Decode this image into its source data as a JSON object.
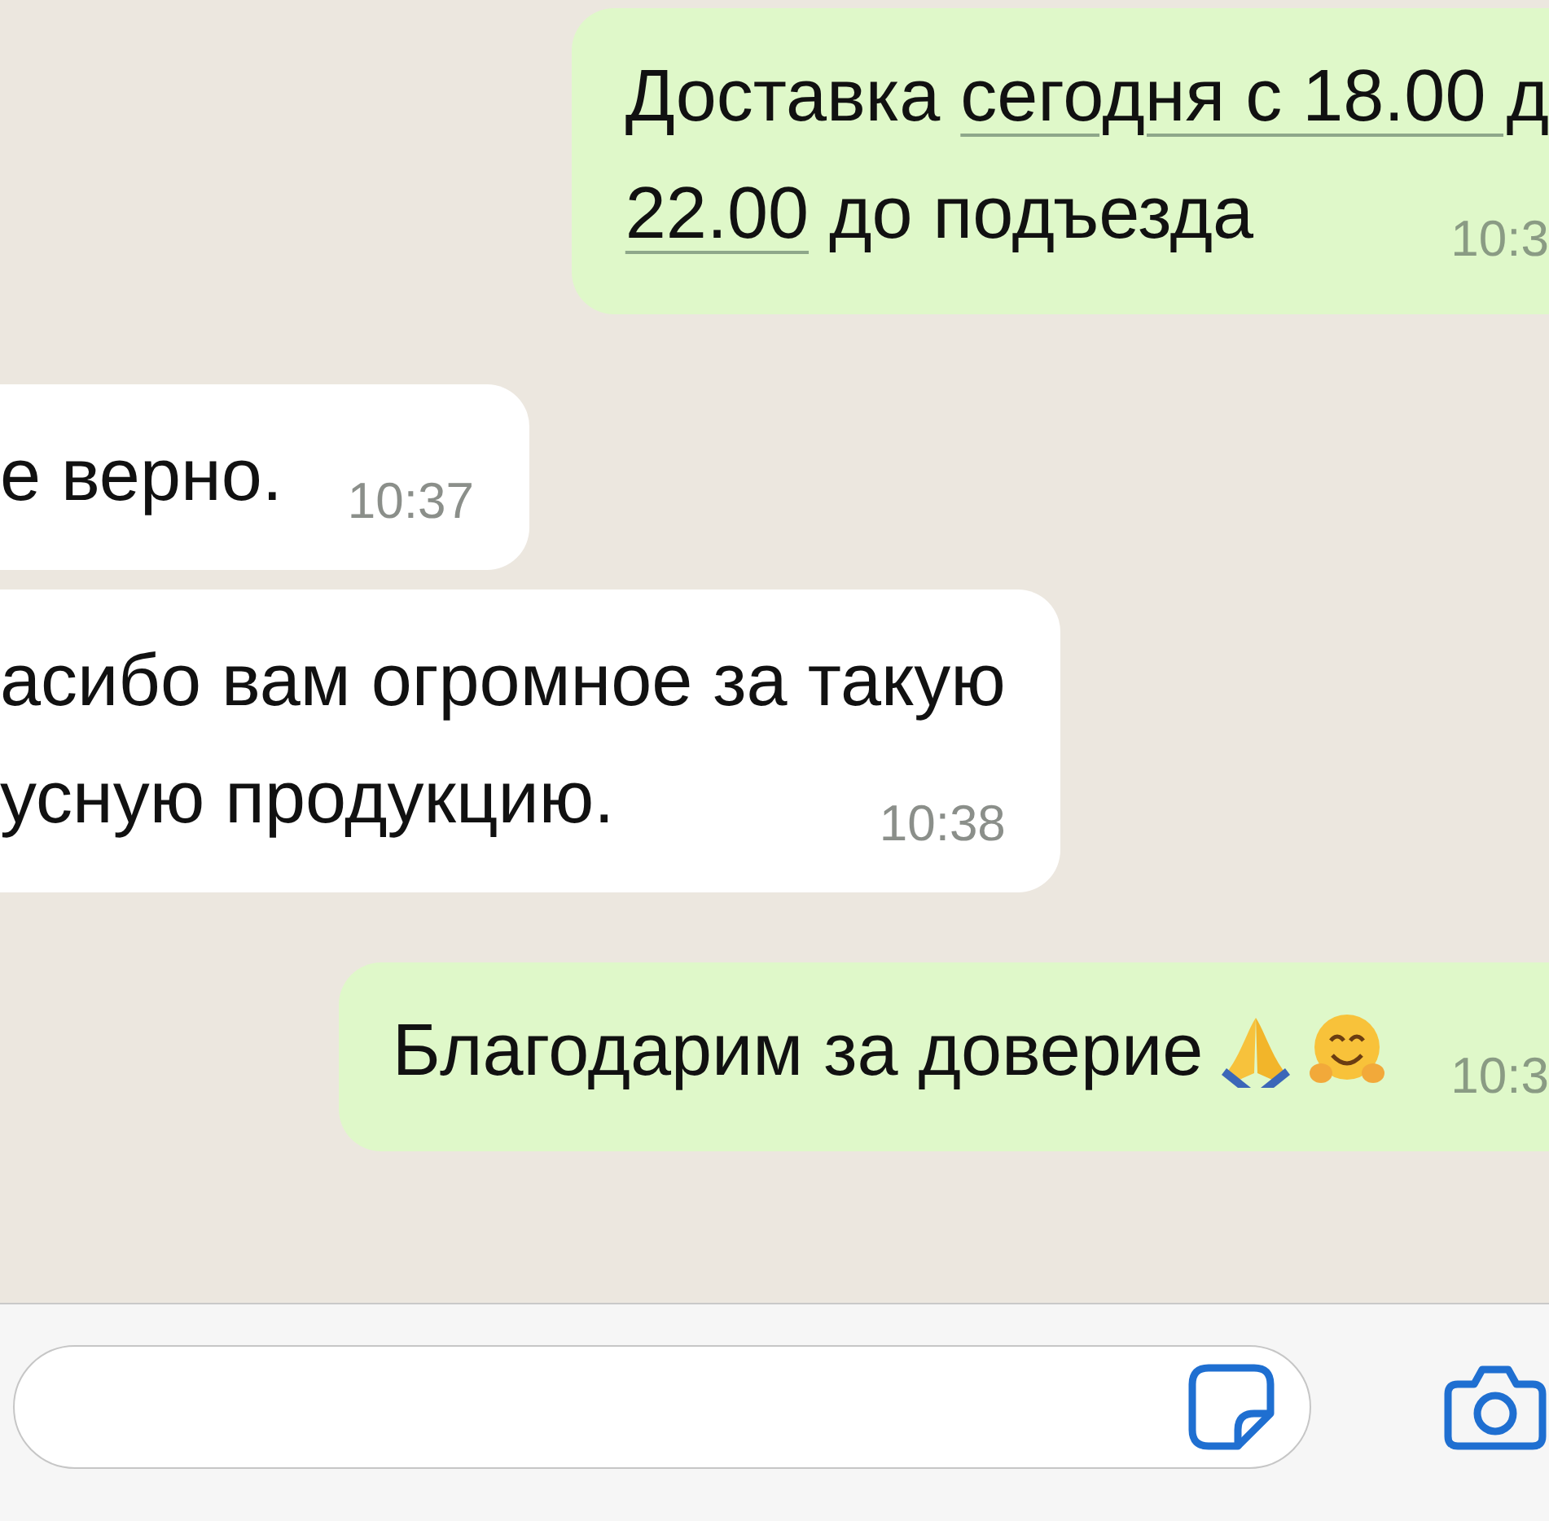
{
  "messages": [
    {
      "kind": "outgoing",
      "lines": [
        [
          {
            "text": "Доставка "
          },
          {
            "text": "сегодня с 18.00 д",
            "kind": "link"
          }
        ],
        [
          {
            "text": "22.00",
            "kind": "link"
          },
          {
            "text": " до подъезда"
          }
        ]
      ],
      "time": "10:3"
    },
    {
      "kind": "incoming",
      "lines": [
        [
          {
            "text": "е верно."
          }
        ]
      ],
      "time": "10:37"
    },
    {
      "kind": "incoming",
      "lines": [
        [
          {
            "text": "асибо вам огромное за такую"
          }
        ],
        [
          {
            "text": "усную продукцию."
          }
        ]
      ],
      "time": "10:38"
    },
    {
      "kind": "outgoing",
      "lines": [
        [
          {
            "text": "Благодарим за доверие "
          }
        ]
      ],
      "emojis": [
        {
          "kind": "pray"
        },
        {
          "kind": "hug"
        }
      ],
      "time": "10:3"
    }
  ]
}
